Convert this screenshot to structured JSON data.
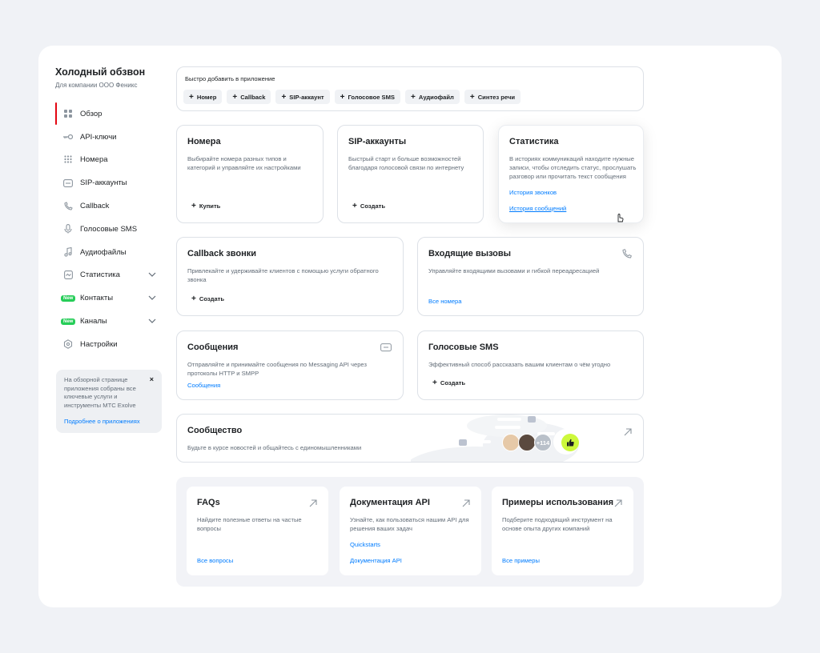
{
  "app": {
    "title": "Холодный обзвон",
    "subtitle": "Для компании ООО Феникс"
  },
  "sidebar": {
    "items": [
      {
        "label": "Обзор",
        "icon": "grid-icon",
        "active": true
      },
      {
        "label": "API-ключи",
        "icon": "key-icon"
      },
      {
        "label": "Номера",
        "icon": "dialpad-icon"
      },
      {
        "label": "SIP-аккаунты",
        "icon": "sip-icon"
      },
      {
        "label": "Callback",
        "icon": "callback-icon"
      },
      {
        "label": "Голосовые SMS",
        "icon": "microphone-icon"
      },
      {
        "label": "Аудиофайлы",
        "icon": "music-icon"
      },
      {
        "label": "Статистика",
        "icon": "chart-icon",
        "expandable": true
      },
      {
        "label": "Контакты",
        "badge": "New",
        "expandable": true
      },
      {
        "label": "Каналы",
        "badge": "New",
        "expandable": true
      },
      {
        "label": "Настройки",
        "icon": "gear-icon"
      }
    ],
    "info": {
      "text": "На обзорной странице приложения собраны все ключевые услуги и инструменты МТС Exolve",
      "link": "Подробнее о приложениях",
      "close": "×"
    }
  },
  "quick_add": {
    "title": "Быстро добавить в приложение",
    "chips": [
      "Номер",
      "Callback",
      "SIP-аккаунт",
      "Голосовое SMS",
      "Аудиофайл",
      "Синтез речи"
    ]
  },
  "cards": {
    "numbers": {
      "title": "Номера",
      "desc": "Выбирайте номера разных типов и категорий и управляйте их настройками",
      "action": "Купить"
    },
    "sip": {
      "title": "SIP-аккаунты",
      "desc": "Быстрый старт и больше возможностей благодаря голосовой связи по интернету",
      "action": "Создать"
    },
    "stats": {
      "title": "Статистика",
      "desc": "В историях коммуникаций находите нужные записи, чтобы отследить статус, прослушать разговор или прочитать текст сообщения",
      "link1": "История звонков",
      "link2": "История сообщений"
    },
    "callback": {
      "title": "Callback звонки",
      "desc": "Привлекайте и удерживайте клиентов с помощью услуги обратного звонка",
      "action": "Создать"
    },
    "incoming": {
      "title": "Входящие вызовы",
      "desc": "Управляйте входящими вызовами и гибкой переадресацией",
      "link": "Все номера"
    },
    "messages": {
      "title": "Сообщения",
      "desc": "Отправляйте и принимайте сообщения по Messaging API через протоколы HTTP и SMPP",
      "link": "Сообщения"
    },
    "voice_sms": {
      "title": "Голосовые SMS",
      "desc": "Эффективный способ рассказать вашим клиентам о чём угодно",
      "action": "Создать"
    },
    "community": {
      "title": "Сообщество",
      "desc": "Будьте в курсе новостей и общайтесь с единомышленниками",
      "count": "+114"
    }
  },
  "resources": {
    "faq": {
      "title": "FAQs",
      "desc": "Найдите полезные ответы на частые вопросы",
      "link": "Все вопросы"
    },
    "docs": {
      "title": "Документация API",
      "desc": "Узнайте, как пользоваться нашим API для решения ваших задач",
      "link1": "Quickstarts",
      "link2": "Документация API"
    },
    "examples": {
      "title": "Примеры использования",
      "desc": "Подберите подходящий инструмент на основе опыта других компаний",
      "link": "Все примеры"
    }
  },
  "colors": {
    "accent": "#e30611",
    "link": "#007cff",
    "new_badge": "#26cd58",
    "like": "#cdf83c"
  }
}
